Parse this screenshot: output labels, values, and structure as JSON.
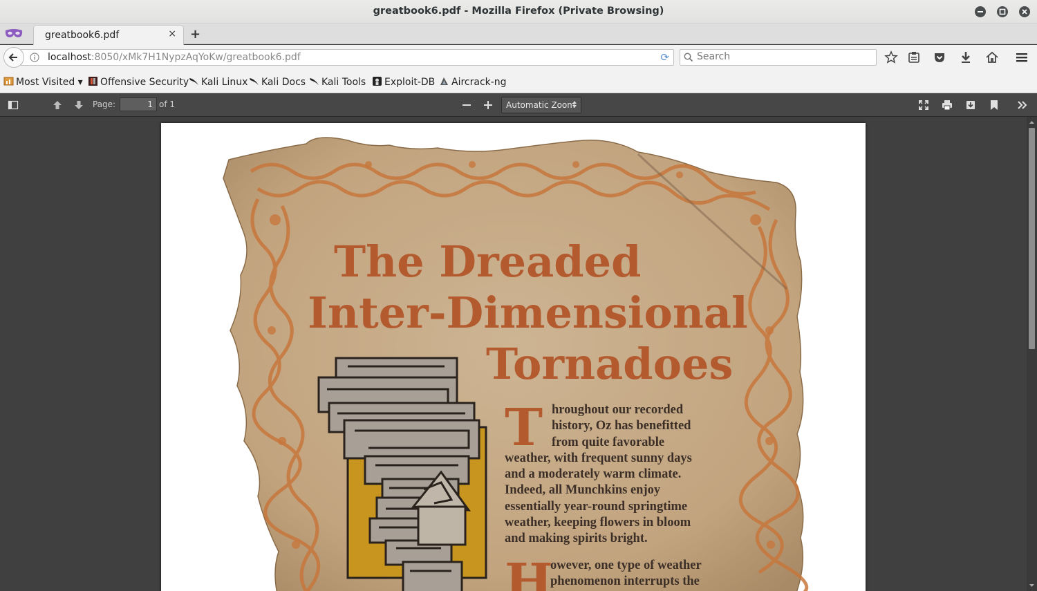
{
  "window": {
    "title": "greatbook6.pdf - Mozilla Firefox (Private Browsing)"
  },
  "tabs": [
    {
      "label": "greatbook6.pdf",
      "close": "×"
    }
  ],
  "new_tab": "+",
  "navbar": {
    "url_host": "localhost",
    "url_path": ":8050/xMk7H1NypzAqYoKw/greatbook6.pdf",
    "search_placeholder": "Search",
    "reload": "⟳"
  },
  "bookmarks": [
    {
      "label": "Most Visited ▾",
      "icon": "most-visited-icon"
    },
    {
      "label": "Offensive Security",
      "icon": "offsec-icon"
    },
    {
      "label": "Kali Linux",
      "icon": "kali-icon"
    },
    {
      "label": "Kali Docs",
      "icon": "kali-icon"
    },
    {
      "label": "Kali Tools",
      "icon": "kali-icon"
    },
    {
      "label": "Exploit-DB",
      "icon": "exploitdb-icon"
    },
    {
      "label": "Aircrack-ng",
      "icon": "aircrack-icon"
    }
  ],
  "pdf_toolbar": {
    "page_label": "Page:",
    "page_value": "1",
    "page_of": "of 1",
    "zoom": "Automatic Zoom",
    "zoom_arrow": "▲▼"
  },
  "document": {
    "title_line1": "The Dreaded",
    "title_line2": "Inter-Dimensional",
    "title_line3": "Tornadoes",
    "para1_dropcap": "T",
    "para1_lines": [
      "hroughout our recorded",
      "history, Oz has benefitted",
      "from quite favorable",
      "weather, with frequent sunny days",
      "and a moderately warm climate.",
      "Indeed, all Munchkins enjoy",
      "essentially year-round springtime",
      "weather, keeping flowers in bloom",
      "and making spirits bright."
    ],
    "para2_dropcap": "H",
    "para2_lines": [
      "owever, one type of weather",
      "phenomenon interrupts the"
    ]
  },
  "colors": {
    "accent": "#b35a2e",
    "parchment": "#c9ae8a",
    "toolbar": "#474747"
  }
}
